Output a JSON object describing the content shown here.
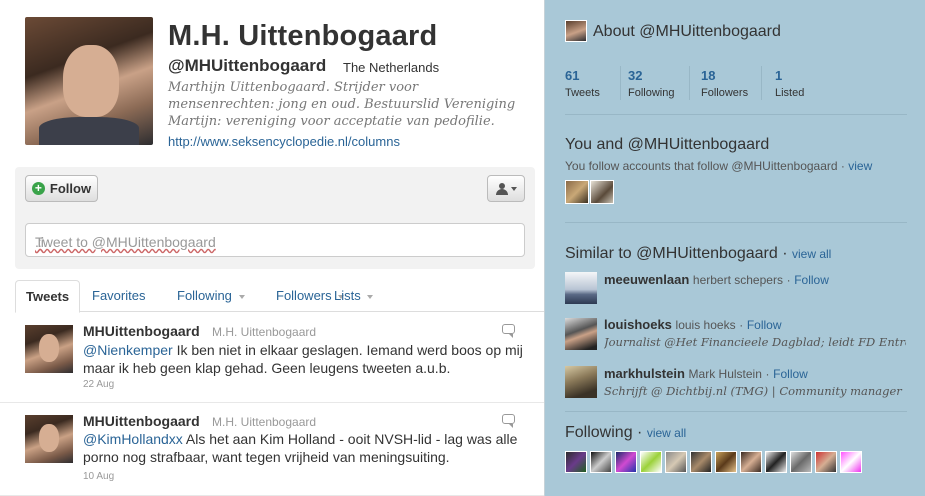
{
  "profile": {
    "name": "M.H. Uittenbogaard",
    "handle": "@MHUittenbogaard",
    "location": "The Netherlands",
    "bio": "Marthijn Uittenbogaard. Strijder voor mensenrechten: jong en oud. Bestuurslid Vereniging Martijn: vereniging voor acceptatie van pedofilie.",
    "url": "http://www.seksencyclopedie.nl/columns"
  },
  "actions": {
    "follow_label": "Follow",
    "tweet_placeholder": "Tweet to @MHUittenbogaard"
  },
  "tabs": [
    {
      "label": "Tweets"
    },
    {
      "label": "Favorites"
    },
    {
      "label": "Following"
    },
    {
      "label": "Followers"
    },
    {
      "label": "Lists"
    }
  ],
  "tweets": [
    {
      "user": "MHUittenbogaard",
      "fullname": "M.H. Uittenbogaard",
      "mention": "@Nienkemper",
      "text": " Ik ben niet in elkaar geslagen. Iemand werd boos op mij maar ik heb geen klap gehad. Geen leugens tweeten a.u.b.",
      "date": "22 Aug"
    },
    {
      "user": "MHUittenbogaard",
      "fullname": "M.H. Uittenbogaard",
      "mention": "@KimHollandxx",
      "text": " Als het aan Kim Holland - ooit NVSH-lid - lag was alle porno nog strafbaar, want tegen vrijheid van meningsuiting.",
      "date": "10 Aug"
    }
  ],
  "sidebar": {
    "about_title": "About @MHUittenbogaard",
    "stats": [
      {
        "num": "61",
        "label": "Tweets"
      },
      {
        "num": "32",
        "label": "Following"
      },
      {
        "num": "18",
        "label": "Followers"
      },
      {
        "num": "1",
        "label": "Listed"
      }
    ],
    "you_and_title": "You and @MHUittenbogaard",
    "you_follow_text": "You follow accounts that follow @MHUittenbogaard ·",
    "you_follow_link": "view",
    "similar_title": "Similar to @MHUittenbogaard",
    "similar_link": "view all",
    "similar": [
      {
        "user": "meeuwenlaan",
        "fullname": "herbert schepers",
        "follow": "Follow",
        "bio": ""
      },
      {
        "user": "louishoeks",
        "fullname": "louis hoeks",
        "follow": "Follow",
        "bio": "Journalist @Het Financieele Dagblad; leidt FD Entrep..."
      },
      {
        "user": "markhulstein",
        "fullname": "Mark Hulstein",
        "follow": "Follow",
        "bio": "Schrijft @ Dichtbij.nl (TMG) | Community manager | Twitter"
      }
    ],
    "following_title": "Following",
    "following_link": "view all"
  }
}
